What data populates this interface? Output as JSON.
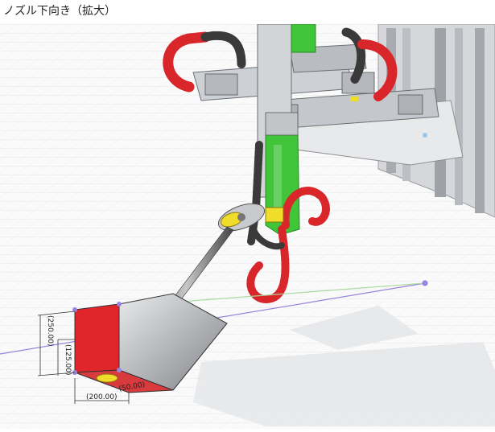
{
  "page": {
    "caption": "ノズル下向き（拡大）"
  },
  "viewport": {
    "label": "CAD 3D view",
    "colors": {
      "background": "#fafafa",
      "grid": "#d9dde3",
      "frame_gray": "#c9ccd0",
      "green_column": "#3fc43a",
      "cable_chain_red": "#d8262b",
      "cable_chain_dark": "#3a3a3a",
      "yellow_part": "#f0dc2a",
      "red_face": "#e0262b",
      "sketch_line": "#9a82e0"
    },
    "dimensions": {
      "vertical_outer": "(250.00)",
      "vertical_inner": "(125.00)",
      "horizontal_outer": "(200.00)",
      "horizontal_inner": "(50.00)"
    }
  }
}
